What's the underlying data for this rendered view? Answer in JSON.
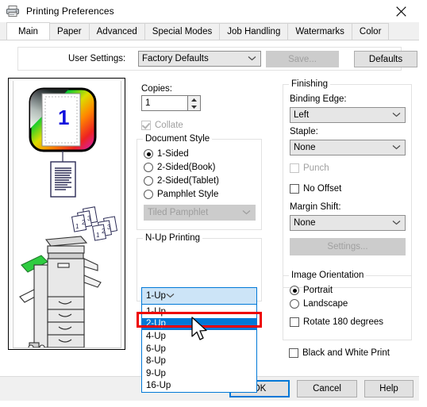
{
  "window": {
    "title": "Printing Preferences",
    "icon": "printer-icon",
    "close_label": "✕",
    "accent_color": "#0078d7",
    "annotation_color": "#ee0000"
  },
  "tabs": [
    {
      "label": "Main",
      "selected": true
    },
    {
      "label": "Paper",
      "selected": false
    },
    {
      "label": "Advanced",
      "selected": false
    },
    {
      "label": "Special Modes",
      "selected": false
    },
    {
      "label": "Job Handling",
      "selected": false
    },
    {
      "label": "Watermarks",
      "selected": false
    },
    {
      "label": "Color",
      "selected": false
    }
  ],
  "user_settings": {
    "label": "User Settings:",
    "value": "Factory Defaults",
    "save_label": "Save...",
    "defaults_label": "Defaults"
  },
  "preview": {
    "page_number": "1",
    "alt": "print preview with printer illustration"
  },
  "copies": {
    "label": "Copies:",
    "value": "1",
    "collate_label": "Collate",
    "collate_checked": true,
    "collate_enabled": false
  },
  "document_style": {
    "legend": "Document Style",
    "options": [
      {
        "label": "1-Sided",
        "selected": true
      },
      {
        "label": "2-Sided(Book)",
        "selected": false
      },
      {
        "label": "2-Sided(Tablet)",
        "selected": false
      },
      {
        "label": "Pamphlet Style",
        "selected": false
      }
    ],
    "pamphlet_combo_value": "Tiled Pamphlet",
    "pamphlet_combo_enabled": false
  },
  "nup": {
    "legend": "N-Up Printing",
    "value": "1-Up",
    "open": true,
    "options": [
      "1-Up",
      "2-Up",
      "4-Up",
      "6-Up",
      "8-Up",
      "9-Up",
      "16-Up"
    ],
    "highlighted": "2-Up"
  },
  "finishing": {
    "legend": "Finishing",
    "binding_edge_label": "Binding Edge:",
    "binding_edge_value": "Left",
    "staple_label": "Staple:",
    "staple_value": "None",
    "punch_label": "Punch",
    "punch_enabled": false,
    "no_offset_label": "No Offset",
    "margin_shift_label": "Margin Shift:",
    "margin_shift_value": "None",
    "settings_label": "Settings...",
    "settings_enabled": false
  },
  "image_orientation": {
    "legend": "Image Orientation",
    "options": [
      {
        "label": "Portrait",
        "selected": true
      },
      {
        "label": "Landscape",
        "selected": false
      }
    ],
    "rotate_label": "Rotate 180 degrees",
    "rotate_checked": false
  },
  "black_and_white": {
    "label": "Black and White Print",
    "checked": false
  },
  "buttons": {
    "ok": "OK",
    "cancel": "Cancel",
    "help": "Help"
  }
}
